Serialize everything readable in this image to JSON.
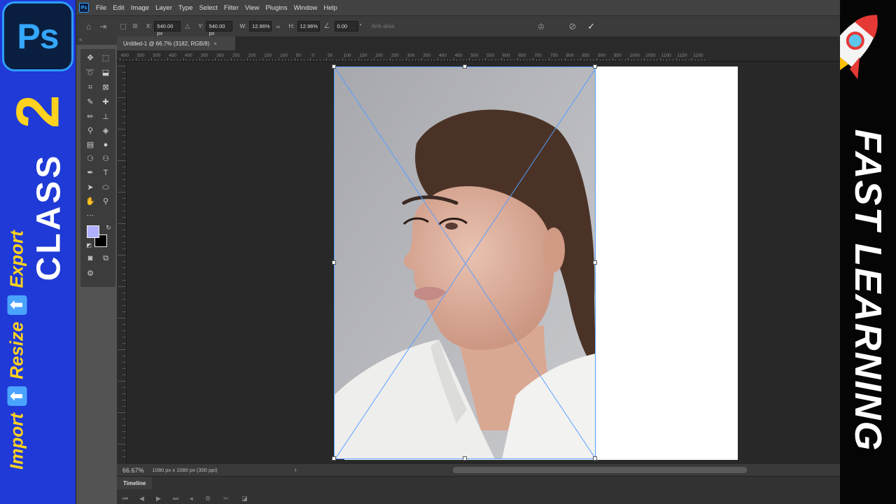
{
  "banner_left": {
    "logo_text": "Ps",
    "class_number": "2",
    "class_word": "CLASS",
    "tagline_parts": [
      "Import",
      "Resize",
      "Export"
    ],
    "tagline_color": "#ffd21f",
    "background_color": "#1f3ad6"
  },
  "banner_right": {
    "title": "FAST LEARNING",
    "icon": "rocket-icon"
  },
  "menu": {
    "app_icon": "Ps",
    "items": [
      "File",
      "Edit",
      "Image",
      "Layer",
      "Type",
      "Select",
      "Filter",
      "View",
      "Plugins",
      "Window",
      "Help"
    ]
  },
  "options": {
    "x_label": "X:",
    "x_value": "540.00 px",
    "y_label": "Y:",
    "y_value": "540.00 px",
    "w_label": "W:",
    "w_value": "12.96%",
    "h_label": "H:",
    "h_value": "12.96%",
    "angle_value": "0.00",
    "angle_unit": "°",
    "antialias_label": "Anti-alias"
  },
  "document": {
    "tab_title": "Untitled-1 @ 66.7% (3182, RGB/8)",
    "tab_close": "×"
  },
  "ruler": {
    "top_labels": [
      "600",
      "550",
      "500",
      "450",
      "400",
      "350",
      "300",
      "250",
      "200",
      "150",
      "100",
      "50",
      "0",
      "50",
      "100",
      "150",
      "200",
      "250",
      "300",
      "350",
      "400",
      "450",
      "500",
      "550",
      "600",
      "650",
      "700",
      "750",
      "800",
      "850",
      "900",
      "950",
      "1000",
      "1050",
      "1100",
      "1150",
      "1200"
    ]
  },
  "status": {
    "zoom": "66.67%",
    "doc_size": "1080 px x 1080 px (300 ppi)",
    "arrow": "›"
  },
  "timeline": {
    "tab_label": "Timeline"
  },
  "colors": {
    "foreground": "#b0b0ff",
    "background": "#000000",
    "transform_accent": "#5a9dff"
  }
}
